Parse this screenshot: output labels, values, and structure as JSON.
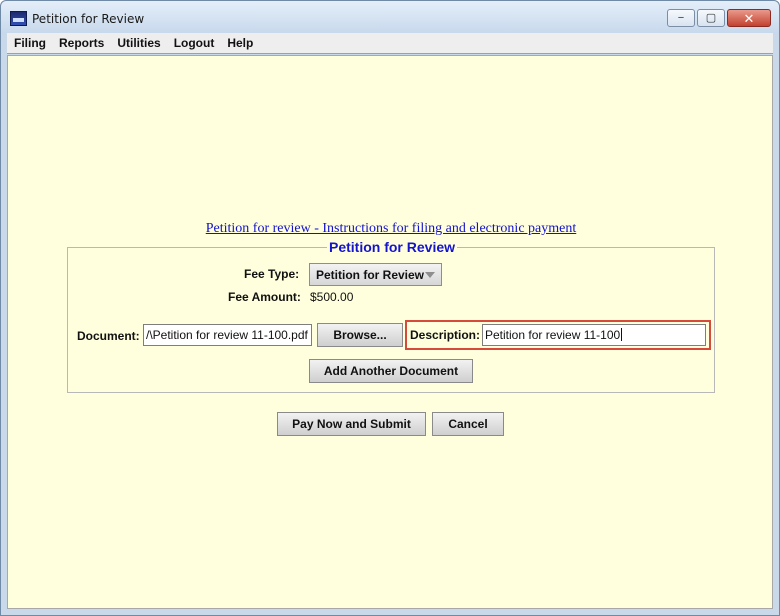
{
  "window": {
    "title": "Petition for Review",
    "controls": {
      "minimize": "−",
      "maximize": "▢",
      "close": "✕"
    }
  },
  "menu": [
    "Filing",
    "Reports",
    "Utilities",
    "Logout",
    "Help"
  ],
  "instructions_link": "Petition for review - Instructions for filing and electronic payment",
  "form": {
    "legend": "Petition for Review",
    "fee_type_label": "Fee Type:",
    "fee_type_value": "Petition for Review",
    "fee_amount_label": "Fee Amount:",
    "fee_amount_value": "$500.00",
    "document_label": "Document:",
    "document_value": "/\\Petition for review 11-100.pdf",
    "browse_label": "Browse...",
    "description_label": "Description:",
    "description_value": "Petition for review 11-100",
    "add_document_label": "Add Another Document"
  },
  "actions": {
    "submit_label": "Pay Now and Submit",
    "cancel_label": "Cancel"
  },
  "colors": {
    "content_bg": "#ffffdd",
    "legend": "#1414cc",
    "link": "#1212cc",
    "highlight": "#d64a3b"
  }
}
